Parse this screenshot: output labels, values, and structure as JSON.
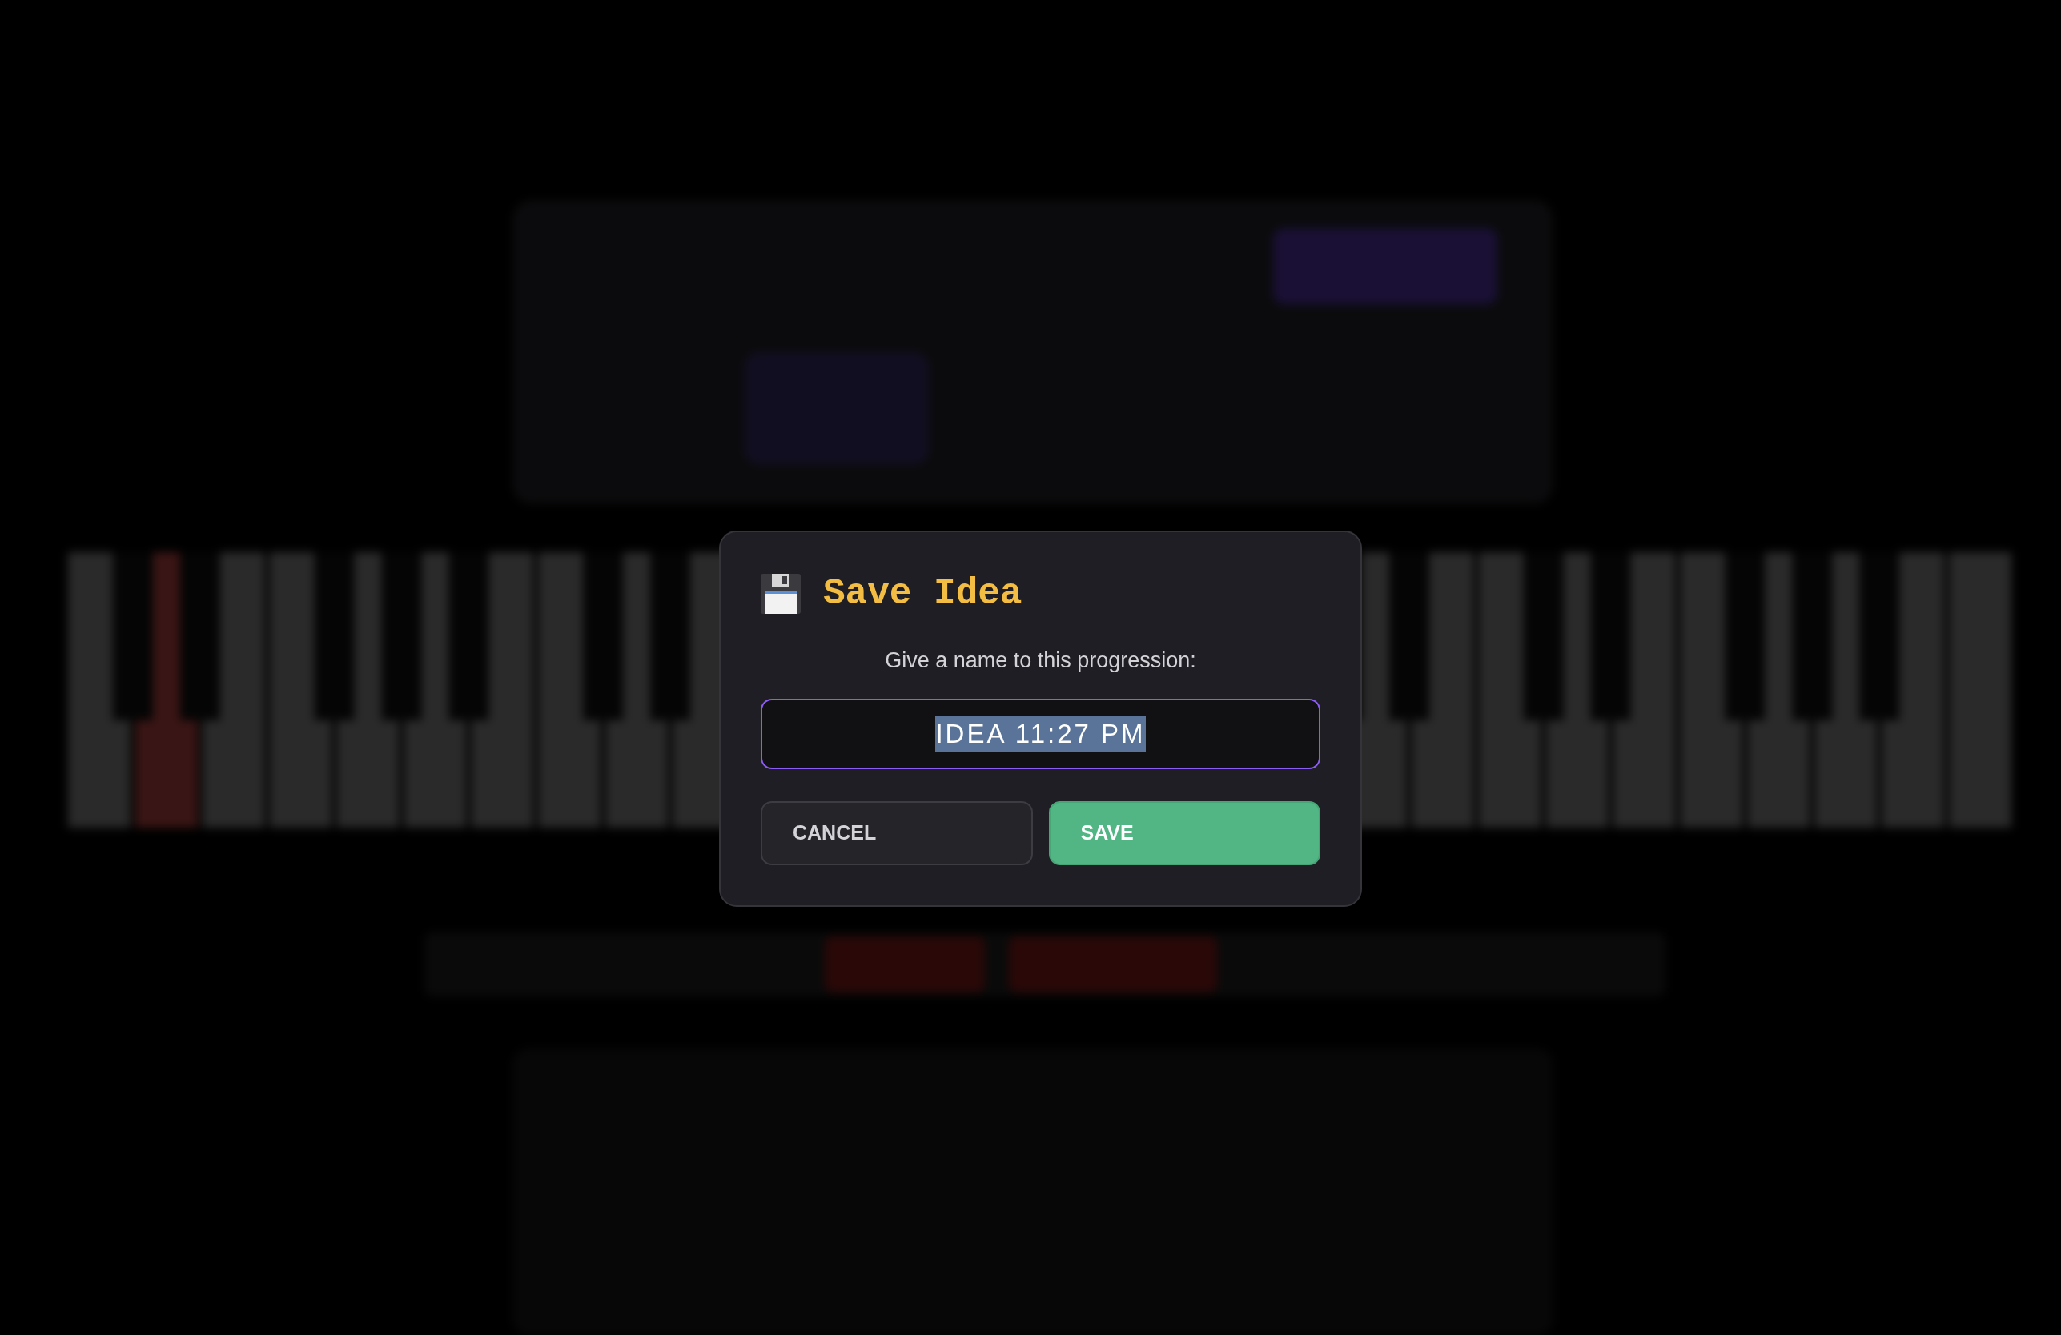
{
  "dialog": {
    "title": "Save Idea",
    "prompt": "Give a name to this progression:",
    "name_field": {
      "value": "IDEA 11:27 PM",
      "value_selected": true
    },
    "buttons": [
      {
        "label": "CANCEL",
        "kind": "secondary"
      },
      {
        "label": "SAVE",
        "kind": "primary"
      }
    ]
  }
}
